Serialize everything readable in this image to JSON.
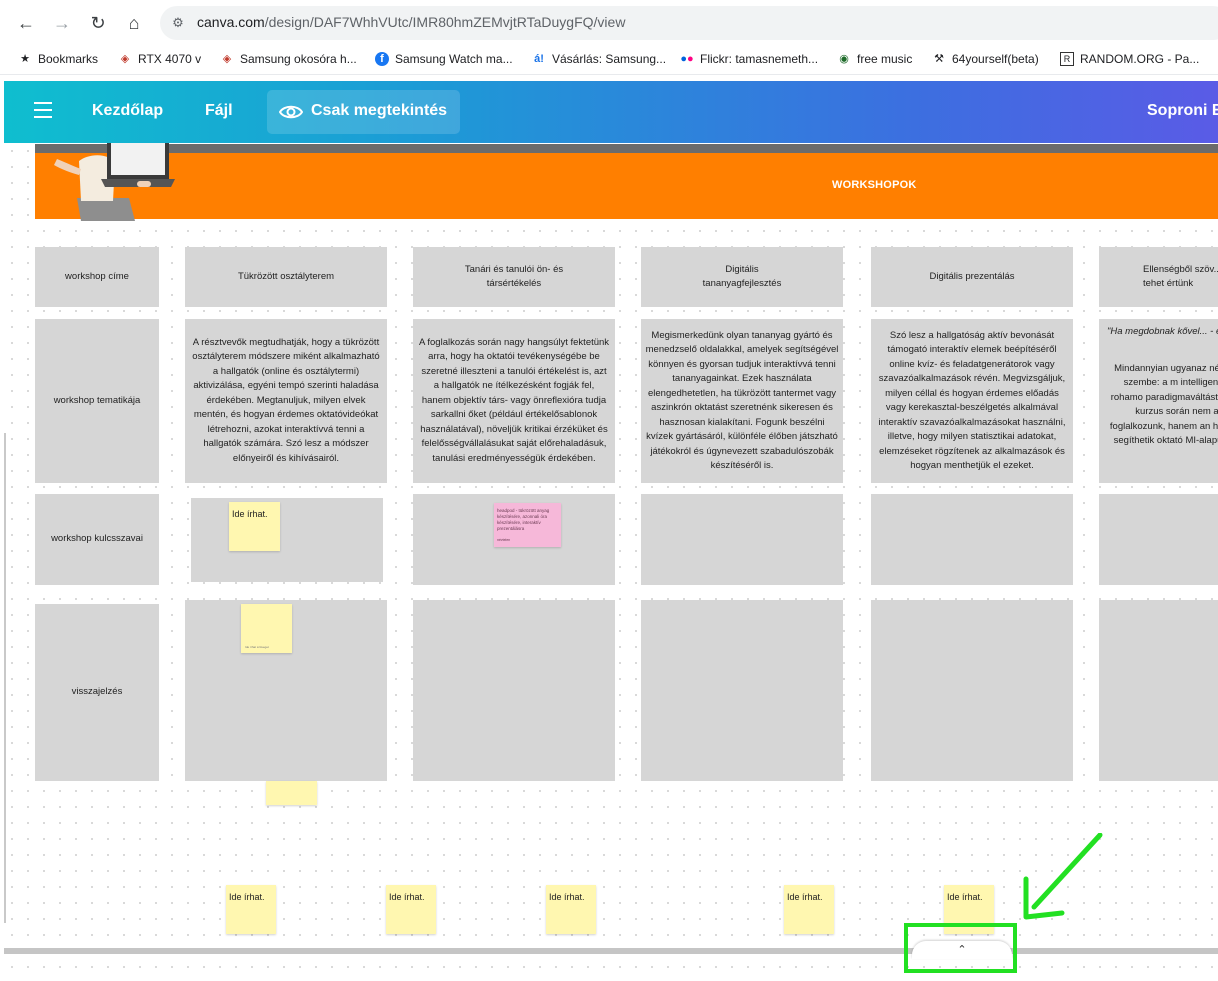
{
  "browser": {
    "url_host": "canva.com",
    "url_path": "/design/DAF7WhhVUtc/IMR80hmZEMvjtRTaDuygFQ/view",
    "bookmarks": [
      {
        "label": "Bookmarks",
        "icon": "star-icon"
      },
      {
        "label": "RTX 4070 v",
        "icon": "tag-icon"
      },
      {
        "label": "Samsung okosóra h...",
        "icon": "tag-icon"
      },
      {
        "label": "Samsung Watch ma...",
        "icon": "facebook-icon"
      },
      {
        "label": "Vásárlás: Samsung...",
        "icon": "arukereso-icon"
      },
      {
        "label": "Flickr: tamasnemeth...",
        "icon": "flickr-icon"
      },
      {
        "label": "free music",
        "icon": "music-icon"
      },
      {
        "label": "64yourself(beta)",
        "icon": "hammer-icon"
      },
      {
        "label": "RANDOM.ORG - Pa...",
        "icon": "random-icon"
      }
    ]
  },
  "header": {
    "home_label": "Kezdőlap",
    "file_label": "Fájl",
    "view_only_label": "Csak megtekintés",
    "user_label": "Soproni E"
  },
  "board": {
    "banner_title": "WORKSHOPOK",
    "row_labels": [
      "workshop címe",
      "workshop tematikája",
      "workshop kulcsszavai",
      "visszajelzés"
    ],
    "columns": [
      {
        "title": "Tükrözött osztályterem",
        "topic": "A résztvevők megtudhatják, hogy a tükrözött osztályterem módszere miként alkalmazható a hallgatók (online és osztálytermi) aktivizálása, egyéni tempó szerinti haladása érdekében. Megtanuljuk, milyen elvek mentén, és hogyan érdemes oktatóvideókat létrehozni, azokat interaktívvá tenni a hallgatók számára. Szó lesz a módszer előnyeiről és kihívásairól."
      },
      {
        "title": "Tanári és tanulói ön- és társértékelés",
        "topic": "A foglalkozás során nagy hangsúlyt fektetünk arra, hogy ha oktatói tevékenységébe be szeretné illeszteni a tanulói értékelést is, azt a hallgatók ne ítélkezésként fogják fel, hanem objektív társ- vagy önreflexióra tudja sarkallni őket (például értékelősablonok használatával), növeljük kritikai érzéküket és felelősségvállalásukat saját előrehaladásuk, tanulási eredményességük érdekében."
      },
      {
        "title": "Digitális tananyagfejlesztés",
        "topic": "Megismerkedünk olyan tananyag gyártó és menedzselő oldalakkal, amelyek segítségével könnyen és gyorsan tudjuk interaktívvá tenni tananyagainkat. Ezek használata elengedhetetlen, ha tükrözött tantermet vagy aszinkrón oktatást szeretnénk sikeresen és hasznosan kialakítani. Fogunk beszélni kvízek gyártásáról, különféle élőben játszható játékokról és úgynevezett szabadulószobák készítéséről is."
      },
      {
        "title": "Digitális prezentálás",
        "topic": "Szó lesz a hallgatóság aktív bevonását támogató interaktív elemek beépítéséről online kvíz- és feladatgenerátorok vagy szavazóalkalmazások révén. Megvizsgáljuk, milyen céllal és hogyan érdemes előadás vagy kerekasztal-beszélgetés alkalmával interaktív szavazóalkalmazásokat használni, illetve, hogy milyen statisztikai adatokat, elemzéseket rögzítenek az alkalmazások és hogyan menthetjük el ezeket."
      },
      {
        "title": "Ellenségből szöv... Mit tehet értünk",
        "topic_quote": "\"Ha megdobnak kővel... - é",
        "topic": "Mindannyian ugyanaz nézünk szembe: a m intelligencia rohamo paradigmaváltást jelent kurzus során nem a foglalkozunk, hanem an hogyan segíthetik oktató MI-alapú felü"
      }
    ],
    "notes": {
      "placeholder": "Ide írhat.",
      "pink_note": "headpod - tükrözött anyag készítésére, azonnali óra készítésére, interaktív prezentálásra",
      "pink_note_author": "névtelen",
      "small_note": "Ide írhat szöveget"
    }
  },
  "ui": {
    "collapse_glyph": "⌃"
  },
  "colors": {
    "banner": "#ff7f00",
    "cell": "#d6d6d6",
    "sticky": "#fff7b0",
    "sticky_pink": "#f6b8d9",
    "highlight": "#22e022"
  }
}
